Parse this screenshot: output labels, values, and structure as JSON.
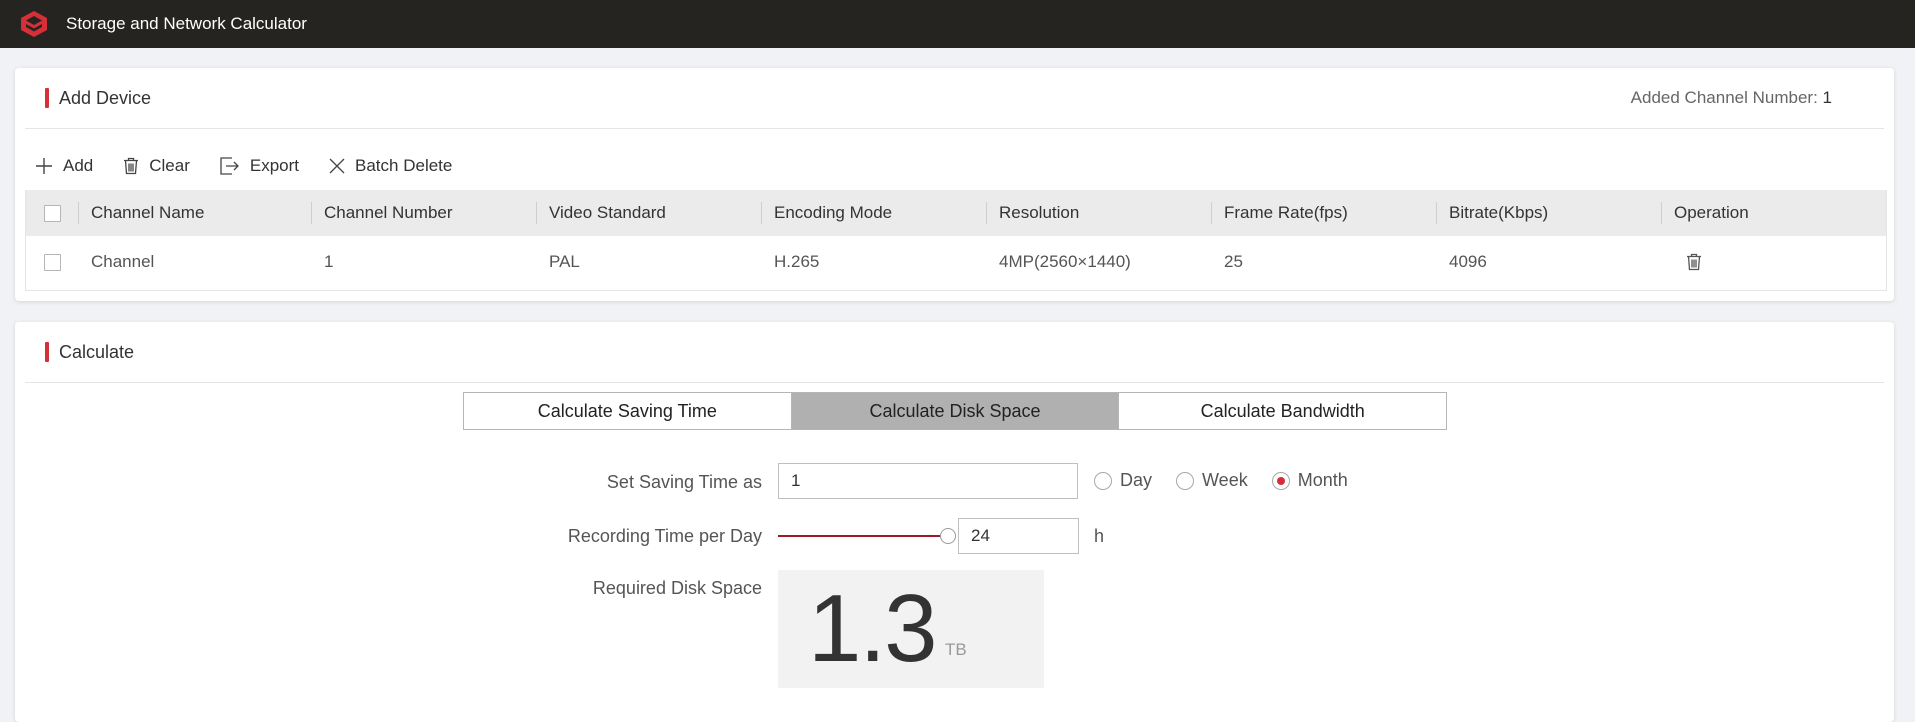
{
  "app": {
    "title": "Storage and Network Calculator",
    "logo": "brand-logo-icon",
    "accent": "#d62f38"
  },
  "add_device": {
    "title": "Add Device",
    "added_label": "Added Channel Number:",
    "added_value": "1",
    "toolbar": {
      "add": "Add",
      "clear": "Clear",
      "export": "Export",
      "batch_delete": "Batch Delete"
    },
    "columns": [
      "Channel Name",
      "Channel Number",
      "Video Standard",
      "Encoding Mode",
      "Resolution",
      "Frame Rate(fps)",
      "Bitrate(Kbps)",
      "Operation"
    ],
    "rows": [
      {
        "name": "Channel",
        "number": "1",
        "standard": "PAL",
        "encoding": "H.265",
        "resolution": "4MP(2560×1440)",
        "fps": "25",
        "bitrate": "4096"
      }
    ]
  },
  "calculate": {
    "title": "Calculate",
    "tabs": [
      {
        "label": "Calculate Saving Time",
        "active": false
      },
      {
        "label": "Calculate Disk Space",
        "active": true
      },
      {
        "label": "Calculate Bandwidth",
        "active": false
      }
    ],
    "saving_time_label": "Set Saving Time as",
    "saving_time_value": "1",
    "period_options": [
      {
        "label": "Day",
        "checked": false
      },
      {
        "label": "Week",
        "checked": false
      },
      {
        "label": "Month",
        "checked": true
      }
    ],
    "recording_label": "Recording Time per Day",
    "recording_value": "24",
    "recording_max": 24,
    "recording_unit": "h",
    "required_label": "Required Disk Space",
    "required_value": "1.3",
    "required_unit": "TB"
  }
}
